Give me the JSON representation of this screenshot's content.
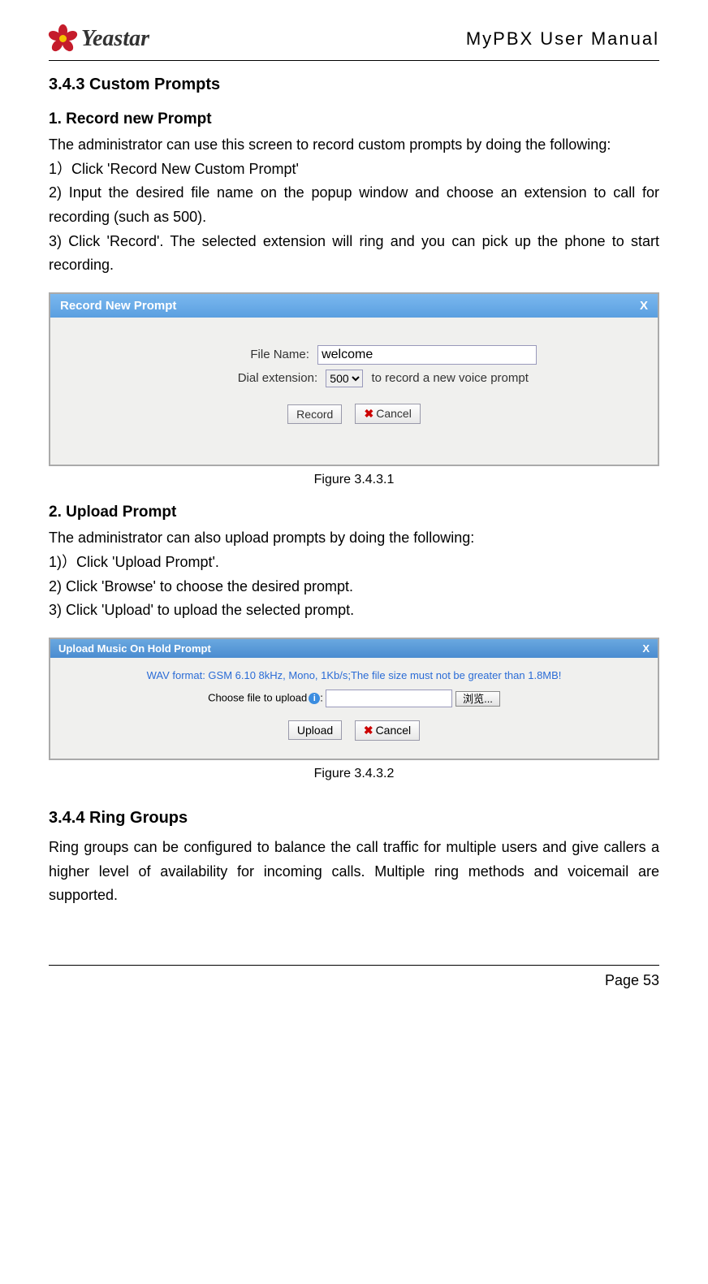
{
  "header": {
    "brand": "Yeastar",
    "doc_title": "MyPBX User Manual"
  },
  "section1": {
    "heading": "3.4.3 Custom Prompts",
    "sub1": "1. Record new Prompt",
    "intro": "The administrator can use this screen to record custom prompts by doing the following:",
    "step1": "1）Click 'Record New Custom Prompt'",
    "step2": "2) Input the desired file name on the popup window and choose an extension to call for recording (such as 500).",
    "step3": "3) Click 'Record'. The selected extension will ring and you can pick up the phone to start recording."
  },
  "dialog1": {
    "title": "Record New Prompt",
    "close": "X",
    "file_label": "File Name:",
    "file_value": "welcome",
    "ext_label": "Dial extension:",
    "ext_value": "500",
    "ext_suffix": "to record a new voice prompt",
    "record_btn": "Record",
    "cancel_btn": "Cancel"
  },
  "caption1": "Figure 3.4.3.1",
  "section2": {
    "sub": "2. Upload Prompt",
    "intro": "The administrator can also upload prompts by doing the following:",
    "step1": "1)）Click 'Upload Prompt'.",
    "step2": "2) Click 'Browse' to choose the desired prompt.",
    "step3": "3) Click 'Upload' to upload the selected prompt."
  },
  "dialog2": {
    "title": "Upload Music On Hold Prompt",
    "close": "X",
    "hint": "WAV format: GSM 6.10 8kHz, Mono, 1Kb/s;The file size must not be greater than 1.8MB!",
    "choose_label": "Choose file to upload",
    "browse_btn": "浏览...",
    "upload_btn": "Upload",
    "cancel_btn": "Cancel"
  },
  "caption2": "Figure 3.4.3.2",
  "section3": {
    "heading": "3.4.4 Ring Groups",
    "body": "Ring groups can be configured to balance the call traffic for multiple users and give callers a higher level of availability for incoming calls. Multiple ring methods and voicemail are supported."
  },
  "footer": {
    "page": "Page 53"
  }
}
